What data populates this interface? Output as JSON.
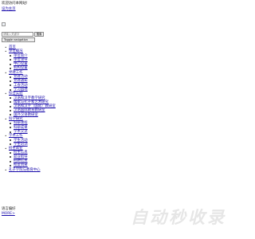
{
  "header": {
    "welcome": "欢迎访问本网站!",
    "home_link": "设为主页"
  },
  "search": {
    "placeholder": "请输入关键字",
    "button": "搜索"
  },
  "nav_toggle": "Toggle navigation",
  "nav": [
    {
      "label": "首页",
      "children": []
    },
    {
      "label": "单位概况",
      "children": [
        "单位简介",
        "单位领导",
        "中心设置",
        "机构设置"
      ]
    },
    {
      "label": "党建工作",
      "children": [
        "党建活动",
        "党建通知",
        "工会活动",
        "学习园地"
      ]
    },
    {
      "label": "综合实验",
      "children": [
        "汉语和汉字教学研究",
        "儒家与孔子和艺术研究",
        "汉语和汉字（国际）教研室",
        "汉语国际教育教研室",
        "国外汉语教研室"
      ]
    },
    {
      "label": "科学研究",
      "children": [
        "科研课程",
        "科研成果",
        "学术交流"
      ]
    },
    {
      "label": "学术工作",
      "children": [
        "学生活动",
        "学生培训"
      ]
    },
    {
      "label": "招生就业",
      "children": [
        "招生信息",
        "就业指导",
        "招聘信息",
        "校友风采"
      ]
    },
    {
      "label": "孔子学院与教育中心",
      "children": []
    }
  ],
  "footer": {
    "prefs_label": "语言偏好",
    "more_link": "MORE>"
  },
  "watermark": "自动秒收录"
}
